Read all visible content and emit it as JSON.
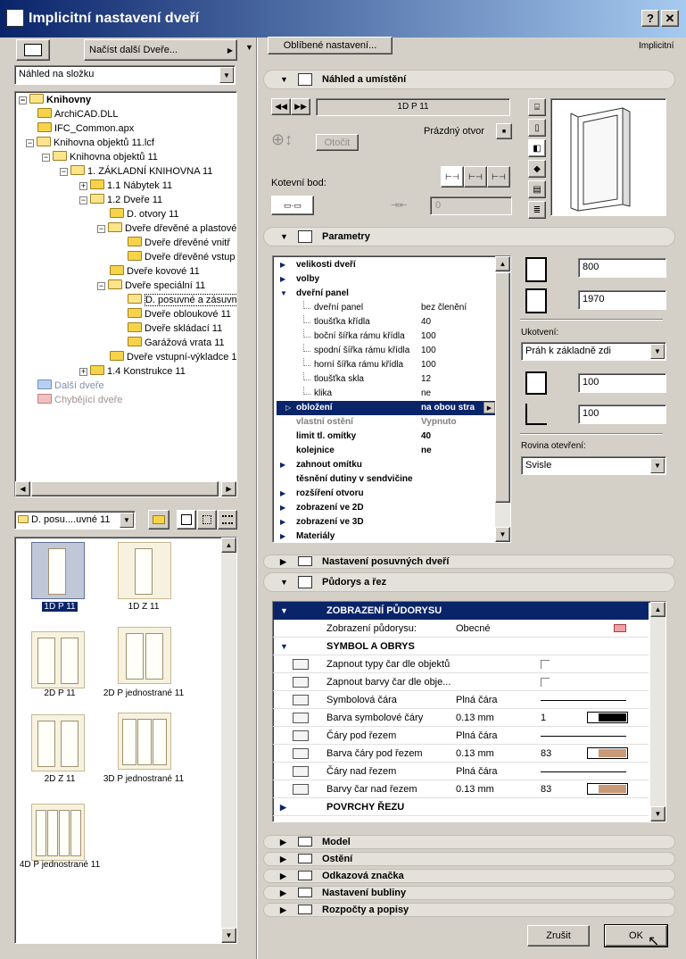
{
  "window": {
    "title": "Implicitní nastavení dveří",
    "help": "?",
    "close": "✕"
  },
  "left": {
    "load_button": "Načíst další Dveře...",
    "view_select": "Náhled na složku",
    "tree": [
      {
        "label": "Knihovny",
        "bold": true
      },
      {
        "label": "ArchiCAD.DLL"
      },
      {
        "label": "IFC_Common.apx"
      },
      {
        "label": "Knihovna objektů 11.lcf"
      },
      {
        "label": "Knihovna objektů 11"
      },
      {
        "label": "1. ZÁKLADNÍ KNIHOVNA 11"
      },
      {
        "label": "1.1 Nábytek 11"
      },
      {
        "label": "1.2 Dveře 11"
      },
      {
        "label": "D. otvory 11"
      },
      {
        "label": "Dveře dřevěné a plastové"
      },
      {
        "label": "Dveře dřevěné vnitř"
      },
      {
        "label": "Dveře dřevěné vstup"
      },
      {
        "label": "Dveře kovové 11"
      },
      {
        "label": "Dveře speciální 11"
      },
      {
        "label": "D. posuvné a zásuvn"
      },
      {
        "label": "Dveře obloukové 11"
      },
      {
        "label": "Dveře skládací 11"
      },
      {
        "label": "Garážová vrata 11"
      },
      {
        "label": "Dveře vstupní-výkladce 1"
      },
      {
        "label": "1.4 Konstrukce 11"
      },
      {
        "label": "Další dveře"
      },
      {
        "label": "Chybějící dveře"
      }
    ],
    "folder_select": "D. posu....uvné 11",
    "thumbs": [
      {
        "label": "1D P 11"
      },
      {
        "label": "1D Z 11"
      },
      {
        "label": "2D P 11"
      },
      {
        "label": "2D P jednostrané 11"
      },
      {
        "label": "2D Z 11"
      },
      {
        "label": "3D P jednostrané 11"
      },
      {
        "label": "4D P jednostrané 11"
      }
    ]
  },
  "right": {
    "favorites": "Oblíbené nastavení...",
    "implicit": "Implicitní",
    "preview": {
      "title": "Náhled a umístění",
      "object_name": "1D P 11",
      "empty_opening": "Prázdný otvor",
      "rotate": "Otočit",
      "anchor": "Kotevní bod:",
      "offset_value": "0"
    },
    "params": {
      "title": "Parametry",
      "rows": [
        {
          "name": "velikosti dveří",
          "value": "",
          "kind": "group"
        },
        {
          "name": "volby",
          "value": "",
          "kind": "group"
        },
        {
          "name": "dveřní panel",
          "value": "",
          "kind": "open"
        },
        {
          "name": "dveřní panel",
          "value": "bez členění",
          "kind": "child"
        },
        {
          "name": "tloušťka křídla",
          "value": "40",
          "kind": "child"
        },
        {
          "name": "boční šířka rámu křídla",
          "value": "100",
          "kind": "child"
        },
        {
          "name": "spodní šířka rámu křídla",
          "value": "100",
          "kind": "child"
        },
        {
          "name": "horní šířka rámu křídla",
          "value": "100",
          "kind": "child"
        },
        {
          "name": "tloušťka skla",
          "value": "12",
          "kind": "child"
        },
        {
          "name": "klika",
          "value": "ne",
          "kind": "child"
        },
        {
          "name": "obložení",
          "value": "na obou stra",
          "kind": "selected"
        },
        {
          "name": "vlastní ostění",
          "value": "Vypnuto",
          "kind": "disabled"
        },
        {
          "name": "limit tl. omítky",
          "value": "40",
          "kind": "bold"
        },
        {
          "name": "kolejnice",
          "value": "ne",
          "kind": "bold"
        },
        {
          "name": "zahnout omítku",
          "value": "",
          "kind": "group"
        },
        {
          "name": "těsnění dutiny v sendvičine",
          "value": "",
          "kind": "bold"
        },
        {
          "name": "rozšíření otvoru",
          "value": "",
          "kind": "group"
        },
        {
          "name": "zobrazení ve 2D",
          "value": "",
          "kind": "group"
        },
        {
          "name": "zobrazení ve 3D",
          "value": "",
          "kind": "group"
        },
        {
          "name": "Materiály",
          "value": "",
          "kind": "group"
        }
      ],
      "width": "800",
      "height": "1970",
      "anchoring_label": "Ukotvení:",
      "anchoring_value": "Práh k základně zdi",
      "sill": "100",
      "sill2": "100",
      "plane_label": "Rovina otevření:",
      "plane_value": "Svisle"
    },
    "sliding": {
      "title": "Nastavení posuvných dveří"
    },
    "floorplan": {
      "title": "Půdorys a řez",
      "header": "ZOBRAZENÍ PŮDORYSU",
      "rows": [
        {
          "name": "Zobrazení půdorysu:",
          "value": "Obecné",
          "extra": ""
        },
        {
          "name": "SYMBOL A OBRYS",
          "value": "",
          "extra": ""
        },
        {
          "name": "Zapnout typy čar dle objektů",
          "value": "",
          "extra": ""
        },
        {
          "name": "Zapnout barvy čar dle obje...",
          "value": "",
          "extra": ""
        },
        {
          "name": "Symbolová čára",
          "value": "Plná čára",
          "extra": ""
        },
        {
          "name": "Barva symbolové čáry",
          "value": "0.13 mm",
          "extra": "1"
        },
        {
          "name": "Čáry pod řezem",
          "value": "Plná čára",
          "extra": ""
        },
        {
          "name": "Barva čáry pod řezem",
          "value": "0.13 mm",
          "extra": "83"
        },
        {
          "name": "Čáry nad řezem",
          "value": "Plná čára",
          "extra": ""
        },
        {
          "name": "Barvy čar nad řezem",
          "value": "0.13 mm",
          "extra": "83"
        },
        {
          "name": "POVRCHY ŘEZU",
          "value": "",
          "extra": ""
        }
      ]
    },
    "sections": [
      "Model",
      "Ostění",
      "Odkazová značka",
      "Nastavení bubliny",
      "Rozpočty a popisy"
    ],
    "cancel": "Zrušit",
    "ok": "OK"
  },
  "colors": {
    "titlebar": "#0a246a",
    "selection": "#0a246a",
    "swatch_black": "#000000",
    "swatch_brown": "#c89a78"
  }
}
